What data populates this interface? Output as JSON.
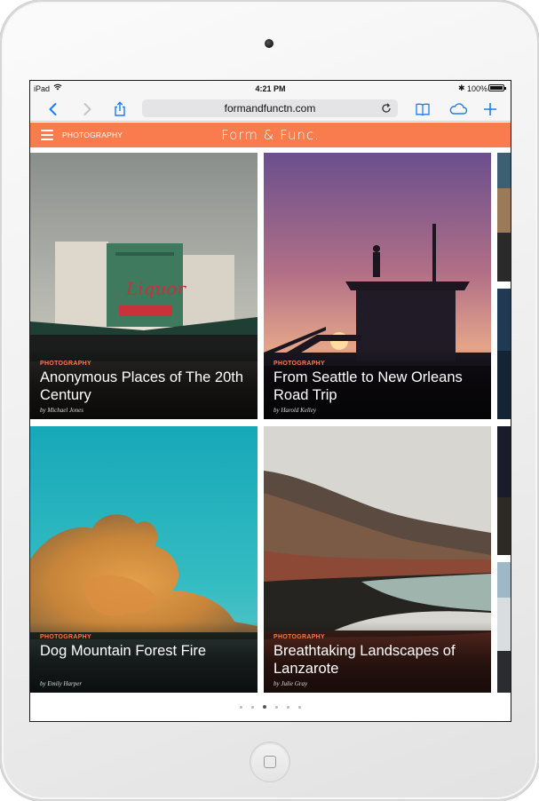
{
  "status_bar": {
    "device": "iPad",
    "time": "4:21 PM",
    "battery": "100%"
  },
  "browser": {
    "url": "formandfunctn.com",
    "icons": [
      "back-icon",
      "forward-icon",
      "share-icon",
      "reload-icon",
      "bookmarks-icon",
      "cloud-tabs-icon",
      "new-tab-icon"
    ]
  },
  "site": {
    "menu_icon": "hamburger-icon",
    "section": "PHOTOGRAPHY",
    "logo": "Form & Func.",
    "accent": "#f97c4f"
  },
  "articles": [
    {
      "category": "PHOTOGRAPHY",
      "title": "Anonymous Places of The 20th Century",
      "byline": "by Michael Jones"
    },
    {
      "category": "PHOTOGRAPHY",
      "title": "From Seattle to New Orleans Road Trip",
      "byline": "by Harold Kelley"
    },
    {
      "category": "PHOTOGRAPHY",
      "title": "Dog Mountain Forest Fire",
      "byline": "by Emily Harper"
    },
    {
      "category": "PHOTOGRAPHY",
      "title": "Breathtaking Landscapes of Lanzarote",
      "byline": "by Julie Gray"
    }
  ],
  "pager": {
    "page_count": 6,
    "current_page": 3
  }
}
